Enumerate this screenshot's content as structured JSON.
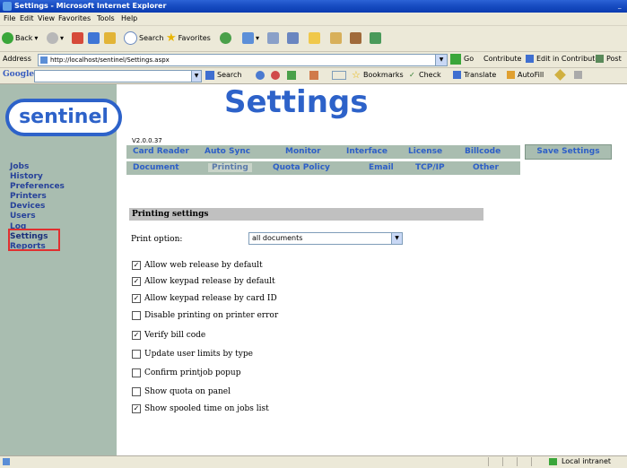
{
  "window": {
    "title": "Settings - Microsoft Internet Explorer"
  },
  "menu": [
    "File",
    "Edit",
    "View",
    "Favorites",
    "Tools",
    "Help"
  ],
  "toolbar": {
    "back": "Back",
    "search": "Search",
    "favorites": "Favorites"
  },
  "address": {
    "label": "Address",
    "url": "http://localhost/sentinel/Settings.aspx",
    "go": "Go",
    "contribute": "Contribute",
    "edit_in_contribute": "Edit in Contribute",
    "post": "Post"
  },
  "google": {
    "logo": "Google",
    "search": "Search",
    "bookmarks": "Bookmarks",
    "check": "Check",
    "translate": "Translate",
    "autofill": "AutoFill"
  },
  "page": {
    "logo": "sentinel",
    "title": "Settings",
    "version": "V2.0.0.37",
    "nav": [
      "Jobs",
      "History",
      "Preferences",
      "Printers",
      "Devices",
      "Users",
      "Log",
      "Settings",
      "Reports"
    ],
    "tabs_row1": [
      "Card Reader",
      "Auto Sync",
      "Monitor",
      "Interface",
      "License",
      "Billcode"
    ],
    "tabs_row2": [
      "Document",
      "Printing",
      "Quota Policy",
      "Email",
      "TCP/IP",
      "Other"
    ],
    "save_button": "Save Settings",
    "section_title": "Printing settings",
    "print_option_label": "Print option:",
    "print_option_value": "all documents",
    "options": [
      {
        "label": "Allow web release by default",
        "checked": true
      },
      {
        "label": "Allow keypad release by default",
        "checked": true
      },
      {
        "label": "Allow keypad release by card ID",
        "checked": true
      },
      {
        "label": "Disable printing on printer error",
        "checked": false
      },
      {
        "label": "Verify bill code",
        "checked": true
      },
      {
        "label": "Update user limits by type",
        "checked": false
      },
      {
        "label": "Confirm printjob popup",
        "checked": false
      },
      {
        "label": "Show quota on panel",
        "checked": false
      },
      {
        "label": "Show spooled time on jobs list",
        "checked": true
      }
    ]
  },
  "status": {
    "zone": "Local intranet"
  }
}
